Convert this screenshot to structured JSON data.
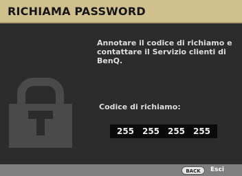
{
  "dialog": {
    "title": "RICHIAMA PASSWORD",
    "message_lines": [
      "Annotare il codice di richiamo e",
      "contattare il Servizio clienti di",
      "BenQ."
    ],
    "code_label": "Codice di richiamo:",
    "recall_code": [
      "255",
      "255",
      "255",
      "255"
    ]
  },
  "footer": {
    "back_button": "BACK",
    "back_action": "Esci"
  },
  "icons": {
    "lock": "padlock-icon"
  },
  "colors": {
    "title_bar": "#cfc08e",
    "panel": "#2c2c2c",
    "lock_icon": "#4a4a4a",
    "footer": "#808080"
  }
}
